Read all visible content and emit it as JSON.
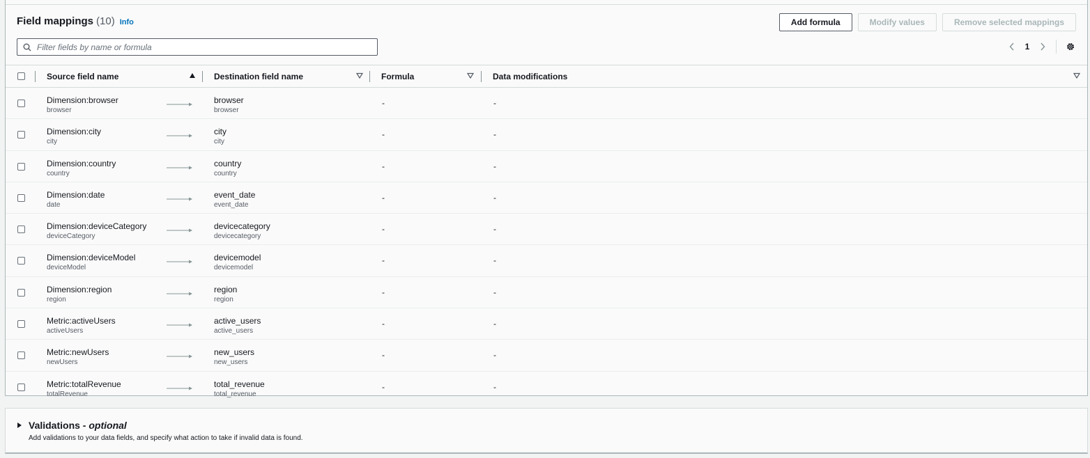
{
  "header": {
    "title": "Field mappings",
    "count": "(10)",
    "info_label": "Info",
    "buttons": {
      "add_formula": "Add formula",
      "modify_values": "Modify values",
      "remove_mappings": "Remove selected mappings"
    }
  },
  "search": {
    "placeholder": "Filter fields by name or formula",
    "value": ""
  },
  "pagination": {
    "current_page": "1"
  },
  "columns": {
    "source": "Source field name",
    "destination": "Destination field name",
    "formula": "Formula",
    "modifications": "Data modifications"
  },
  "rows": [
    {
      "source": "Dimension:browser",
      "source_sub": "browser",
      "dest": "browser",
      "dest_sub": "browser",
      "formula": "-",
      "mods": "-"
    },
    {
      "source": "Dimension:city",
      "source_sub": "city",
      "dest": "city",
      "dest_sub": "city",
      "formula": "-",
      "mods": "-"
    },
    {
      "source": "Dimension:country",
      "source_sub": "country",
      "dest": "country",
      "dest_sub": "country",
      "formula": "-",
      "mods": "-"
    },
    {
      "source": "Dimension:date",
      "source_sub": "date",
      "dest": "event_date",
      "dest_sub": "event_date",
      "formula": "-",
      "mods": "-"
    },
    {
      "source": "Dimension:deviceCategory",
      "source_sub": "deviceCategory",
      "dest": "devicecategory",
      "dest_sub": "devicecategory",
      "formula": "-",
      "mods": "-"
    },
    {
      "source": "Dimension:deviceModel",
      "source_sub": "deviceModel",
      "dest": "devicemodel",
      "dest_sub": "devicemodel",
      "formula": "-",
      "mods": "-"
    },
    {
      "source": "Dimension:region",
      "source_sub": "region",
      "dest": "region",
      "dest_sub": "region",
      "formula": "-",
      "mods": "-"
    },
    {
      "source": "Metric:activeUsers",
      "source_sub": "activeUsers",
      "dest": "active_users",
      "dest_sub": "active_users",
      "formula": "-",
      "mods": "-"
    },
    {
      "source": "Metric:newUsers",
      "source_sub": "newUsers",
      "dest": "new_users",
      "dest_sub": "new_users",
      "formula": "-",
      "mods": "-"
    },
    {
      "source": "Metric:totalRevenue",
      "source_sub": "totalRevenue",
      "dest": "total_revenue",
      "dest_sub": "total_revenue",
      "formula": "-",
      "mods": "-"
    }
  ],
  "validations": {
    "title": "Validations - ",
    "title_optional": "optional",
    "description": "Add validations to your data fields, and specify what action to take if invalid data is found."
  },
  "colors": {
    "link": "#0073bb",
    "border": "#aab7b8",
    "text": "#16191f"
  }
}
